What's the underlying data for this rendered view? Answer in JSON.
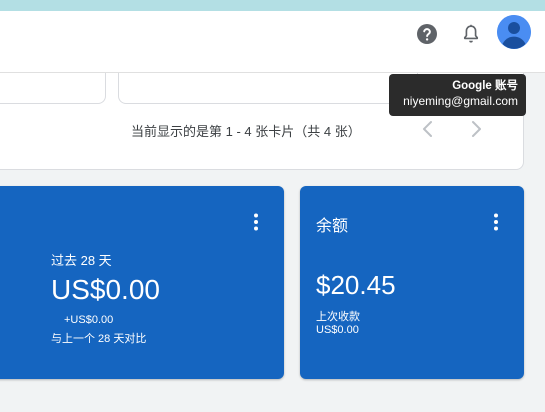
{
  "header": {
    "icons": {
      "help": "help-circle-icon",
      "notifications": "bell-icon",
      "account": "account-avatar-icon"
    }
  },
  "tooltip": {
    "title": "Google 账号",
    "email": "niyeming@gmail.com"
  },
  "pager": {
    "text": "当前显示的是第 1 - 4 张卡片（共 4 张）",
    "icons": {
      "prev": "chevron-left-icon",
      "next": "chevron-right-icon"
    }
  },
  "earnings_card": {
    "period": "过去 28 天",
    "amount": "US$0.00",
    "delta": "+US$0.00",
    "comparison": "与上一个 28 天对比",
    "menu_icon": "more-vert-icon"
  },
  "balance_card": {
    "title": "余额",
    "amount": "$20.45",
    "last_payment_label": "上次收款",
    "last_payment_value": "US$0.00",
    "menu_icon": "more-vert-icon"
  },
  "colors": {
    "card_blue": "#1565c0",
    "top_strip": "#b3dfe4",
    "avatar_blue": "#4a8df2",
    "tooltip_bg": "#2b2b2b"
  }
}
